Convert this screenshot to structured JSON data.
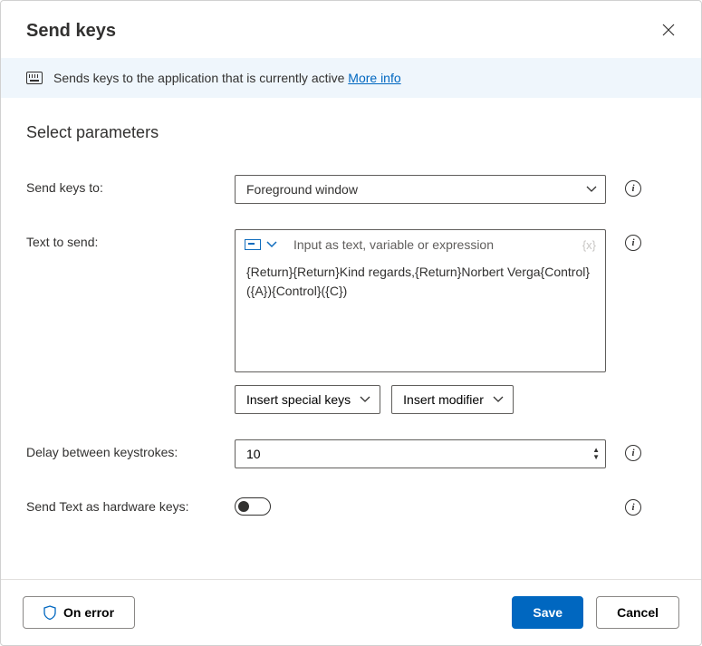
{
  "header": {
    "title": "Send keys"
  },
  "infobar": {
    "text": "Sends keys to the application that is currently active ",
    "link": "More info"
  },
  "section_title": "Select parameters",
  "fields": {
    "send_keys_to": {
      "label": "Send keys to:",
      "value": "Foreground window"
    },
    "text_to_send": {
      "label": "Text to send:",
      "hint": "Input as text, variable or expression",
      "value": "{Return}{Return}Kind regards,{Return}Norbert Verga{Control}({A}){Control}({C})",
      "variable_mark": "{x}",
      "insert_special": "Insert special keys",
      "insert_modifier": "Insert modifier"
    },
    "delay": {
      "label": "Delay between keystrokes:",
      "value": "10"
    },
    "hardware": {
      "label": "Send Text as hardware keys:",
      "value": false
    }
  },
  "footer": {
    "on_error": "On error",
    "save": "Save",
    "cancel": "Cancel"
  }
}
